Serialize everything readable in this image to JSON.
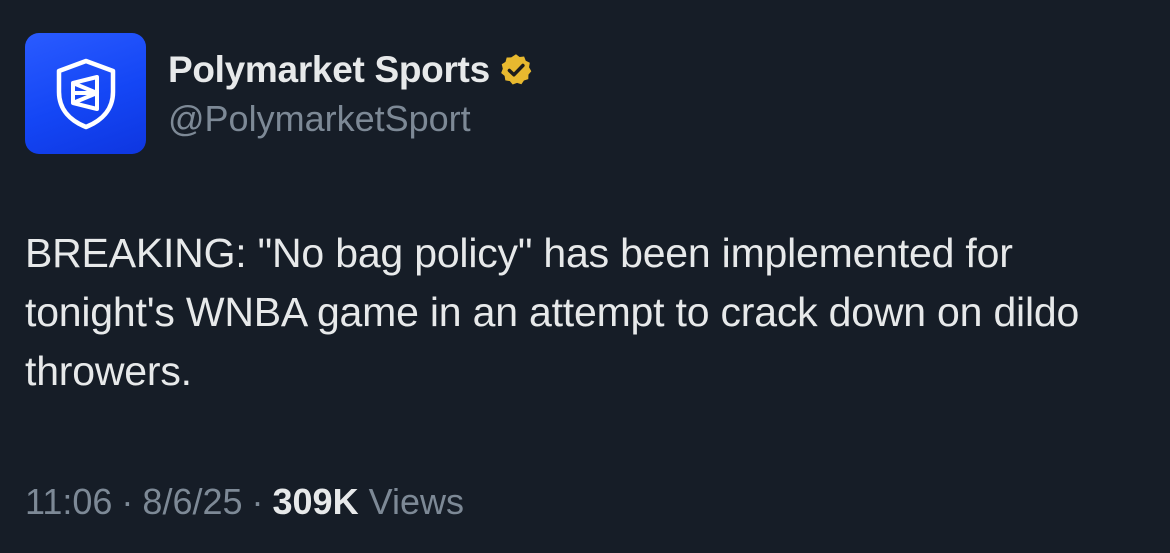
{
  "author": {
    "display_name": "Polymarket Sports",
    "handle": "@PolymarketSport",
    "verified_badge_color": "#e8b92f",
    "avatar_color": "#1a4cff",
    "avatar_icon": "shield-logo-icon"
  },
  "tweet": {
    "text": "BREAKING: \"No bag policy\" has been implemented for tonight's WNBA game in an attempt to crack down on dildo throwers."
  },
  "meta": {
    "time": "11:06",
    "separator": "·",
    "date": "8/6/25",
    "views_count": "309K",
    "views_label": "Views"
  },
  "colors": {
    "background": "#161d27",
    "primary_text": "#e7e9ea",
    "secondary_text": "#7d8996"
  }
}
